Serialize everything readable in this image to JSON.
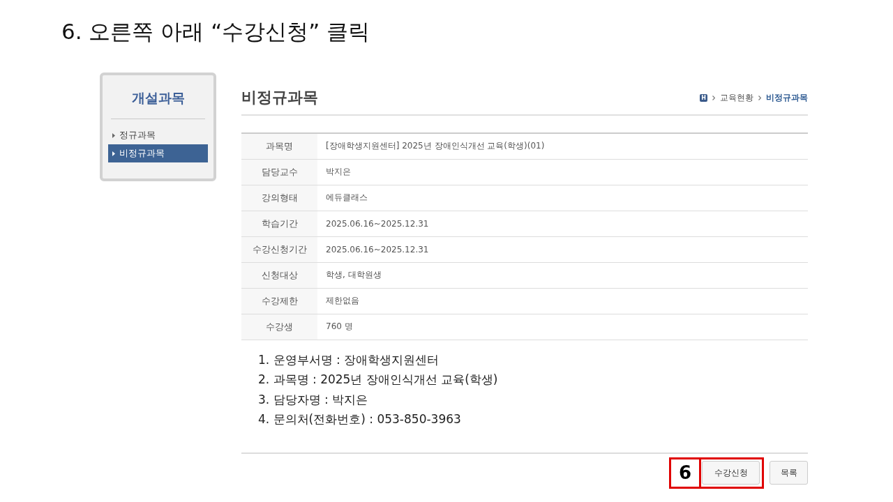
{
  "slide": {
    "title": "6. 오른쪽 아래 “수강신청” 클릭"
  },
  "sidebar": {
    "title": "개설과목",
    "items": [
      {
        "label": "정규과목",
        "selected": false
      },
      {
        "label": "비정규과목",
        "selected": true
      }
    ]
  },
  "page": {
    "heading": "비정규과목",
    "breadcrumb": {
      "home": "H",
      "items": [
        {
          "label": "교육현황",
          "current": false
        },
        {
          "label": "비정규과목",
          "current": true
        }
      ]
    }
  },
  "details": [
    {
      "label": "과목명",
      "value": "[장애학생지원센터] 2025년 장애인식개선 교육(학생)(01)"
    },
    {
      "label": "담당교수",
      "value": "박지은"
    },
    {
      "label": "강의형태",
      "value": "에듀클래스"
    },
    {
      "label": "학습기간",
      "value": "2025.06.16~2025.12.31"
    },
    {
      "label": "수강신청기간",
      "value": "2025.06.16~2025.12.31"
    },
    {
      "label": "신청대상",
      "value": "학생, 대학원생"
    },
    {
      "label": "수강제한",
      "value": "제한없음"
    },
    {
      "label": "수강생",
      "value": "760 명"
    }
  ],
  "notes": [
    "1. 운영부서명 : 장애학생지원센터",
    "2. 과목명 : 2025년 장애인식개선 교육(학생)",
    "3. 담당자명 : 박지은",
    "4. 문의처(전화번호) : 053-850-3963"
  ],
  "buttons": [
    {
      "label": "수강신청",
      "highlighted": true
    },
    {
      "label": "목록",
      "highlighted": false
    }
  ],
  "callout": {
    "label": "6"
  }
}
